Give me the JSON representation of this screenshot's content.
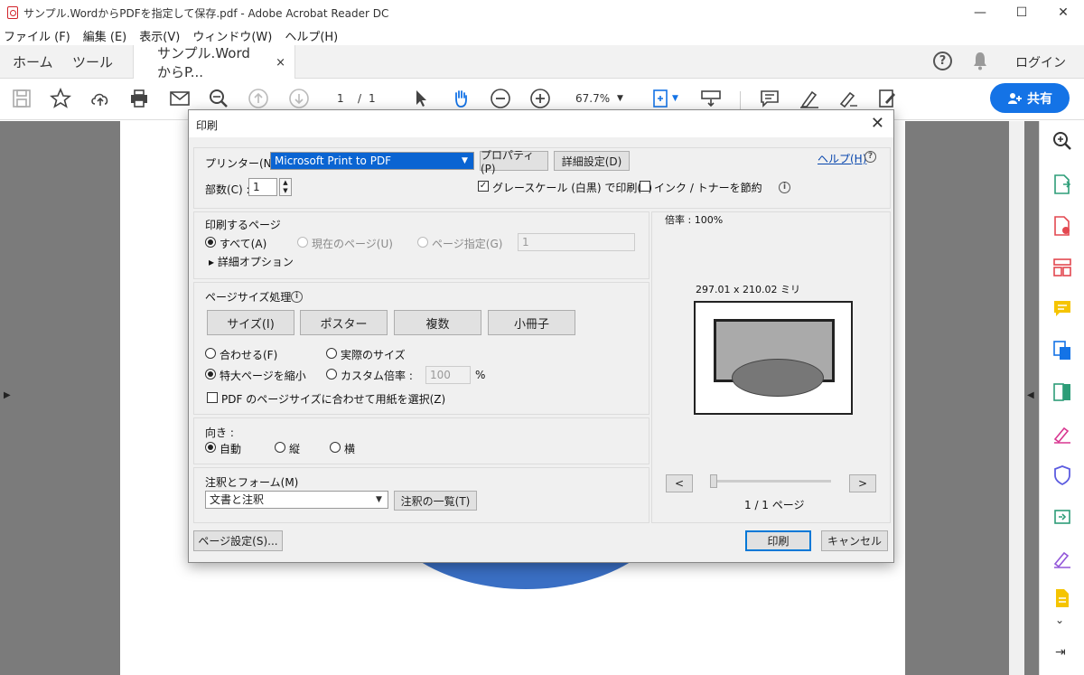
{
  "window": {
    "title": "サンプル.WordからPDFを指定して保存.pdf - Adobe Acrobat Reader DC",
    "minimize": "—",
    "maximize": "☐",
    "close": "✕"
  },
  "menu": [
    "ファイル (F)",
    "編集 (E)",
    "表示(V)",
    "ウィンドウ(W)",
    "ヘルプ(H)"
  ],
  "tabs": {
    "home": "ホーム",
    "tools": "ツール",
    "doc": "サンプル.WordからP...",
    "doc_close": "×",
    "login": "ログイン",
    "help_glyph": "?"
  },
  "toolbar": {
    "page_current": "1",
    "page_sep": "/",
    "page_total": "1",
    "zoom": "67.7%",
    "share_label": "共有"
  },
  "dialog": {
    "title": "印刷",
    "close": "✕",
    "printer_label": "プリンター(N) :",
    "printer_value": "Microsoft Print to PDF",
    "properties_btn": "プロパティ(P)",
    "advanced_btn": "詳細設定(D)",
    "help_link": "ヘルプ(H)",
    "copies_label": "部数(C) :",
    "copies_value": "1",
    "grayscale_label": "グレースケール (白黒) で印刷(Y)",
    "grayscale_checked": true,
    "ink_save_label": "インク / トナーを節約",
    "ink_save_checked": false,
    "pages_section": {
      "title": "印刷するページ",
      "all": "すべて(A)",
      "current": "現在のページ(U)",
      "range": "ページ指定(G)",
      "range_value": "1",
      "more_options": "▸ 詳細オプション"
    },
    "sizing_section": {
      "title": "ページサイズ処理",
      "buttons": [
        "サイズ(I)",
        "ポスター",
        "複数",
        "小冊子"
      ],
      "fit": "合わせる(F)",
      "actual": "実際のサイズ",
      "shrink": "特大ページを縮小",
      "custom": "カスタム倍率 :",
      "custom_value": "100",
      "percent": "%",
      "choose_paper": "PDF のページサイズに合わせて用紙を選択(Z)"
    },
    "orientation_section": {
      "title": "向き :",
      "auto": "自動",
      "portrait": "縦",
      "landscape": "横"
    },
    "comments_section": {
      "title": "注釈とフォーム(M)",
      "value": "文書と注釈",
      "summary_btn": "注釈の一覧(T)"
    },
    "preview": {
      "scale": "倍率 : 100%",
      "dimensions": "297.01 x 210.02 ミリ",
      "prev": "<",
      "next": ">",
      "page_info": "1 / 1 ページ"
    },
    "page_setup_btn": "ページ設定(S)...",
    "print_btn": "印刷",
    "cancel_btn": "キャンセル"
  }
}
